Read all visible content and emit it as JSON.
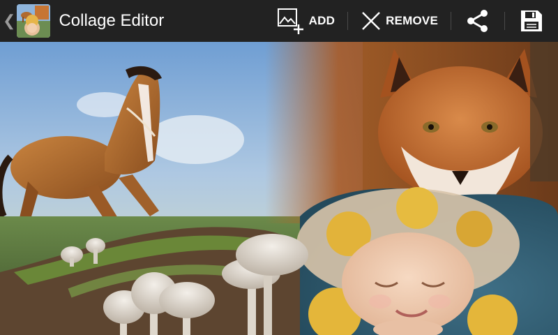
{
  "app": {
    "title": "Collage Editor",
    "back_glyph": "❮",
    "icon_name": "collage-app-icon"
  },
  "toolbar": {
    "add_label": "ADD",
    "add_icon": "add-image-icon",
    "remove_label": "REMOVE",
    "remove_icon": "close-icon",
    "share_icon": "share-icon",
    "save_icon": "save-icon"
  },
  "colors": {
    "action_bar": "#222222",
    "text": "#ffffff"
  },
  "collage": {
    "photos": [
      "horse",
      "fox",
      "sleeping-baby",
      "mushrooms"
    ]
  }
}
